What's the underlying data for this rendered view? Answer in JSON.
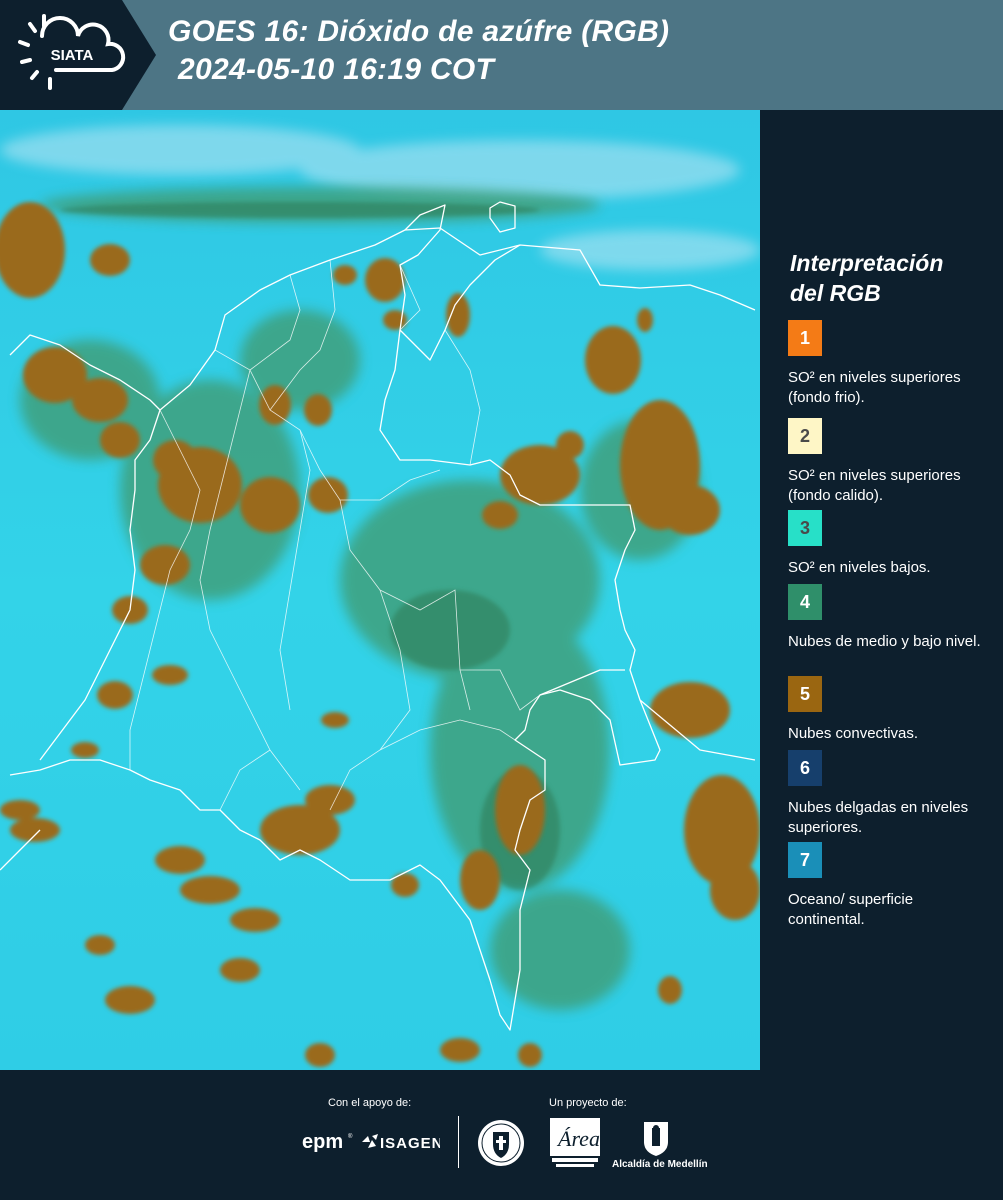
{
  "header": {
    "logo_text": "SIATA",
    "title_line1": "GOES 16: Dióxido de azúfre (RGB)",
    "title_line2": "2024-05-10 16:19 COT"
  },
  "legend": {
    "title_line1": "Interpretación",
    "title_line2": "del RGB",
    "items": [
      {
        "number": "1",
        "label": "SO² en niveles superiores (fondo frio).",
        "color": "#f47b16",
        "text_color": "#ffffff"
      },
      {
        "number": "2",
        "label": "SO² en niveles superiores (fondo calido).",
        "color": "#fef6c6",
        "text_color": "#4a4a4a"
      },
      {
        "number": "3",
        "label": "SO² en niveles bajos.",
        "color": "#27e0c8",
        "text_color": "#4a4a4a"
      },
      {
        "number": "4",
        "label": "Nubes de medio y bajo nivel.",
        "color": "#2f8f6a",
        "text_color": "#ffffff"
      },
      {
        "number": "5",
        "label": "Nubes convectivas.",
        "color": "#9a6611",
        "text_color": "#ffffff"
      },
      {
        "number": "6",
        "label": "Nubes delgadas en niveles superiores.",
        "color": "#163f6c",
        "text_color": "#ffffff"
      },
      {
        "number": "7",
        "label": "Oceano/ superficie continental.",
        "color": "#1a8fb8",
        "text_color": "#ffffff"
      }
    ]
  },
  "map": {
    "background_color": "#2ecfe6",
    "cloud_color": "#9a6b1e",
    "green_color": "#3f9d76",
    "border_color": "#ffffff"
  },
  "footer": {
    "support_label": "Con el apoyo de:",
    "project_label": "Un proyecto de:",
    "sponsors": [
      {
        "name": "epm",
        "icon": "epm-logo"
      },
      {
        "name": "ISAGEN",
        "icon": "isagen-logo"
      }
    ],
    "partners": [
      {
        "name": "Medellín seal",
        "icon": "medellin-seal"
      },
      {
        "name": "Área Metropolitana Valle de Aburrá",
        "icon": "area-metropolitana-logo"
      },
      {
        "name": "Alcaldía de Medellín",
        "icon": "alcaldia-logo"
      }
    ],
    "alcaldia_label": "Alcaldía de Medellín"
  }
}
